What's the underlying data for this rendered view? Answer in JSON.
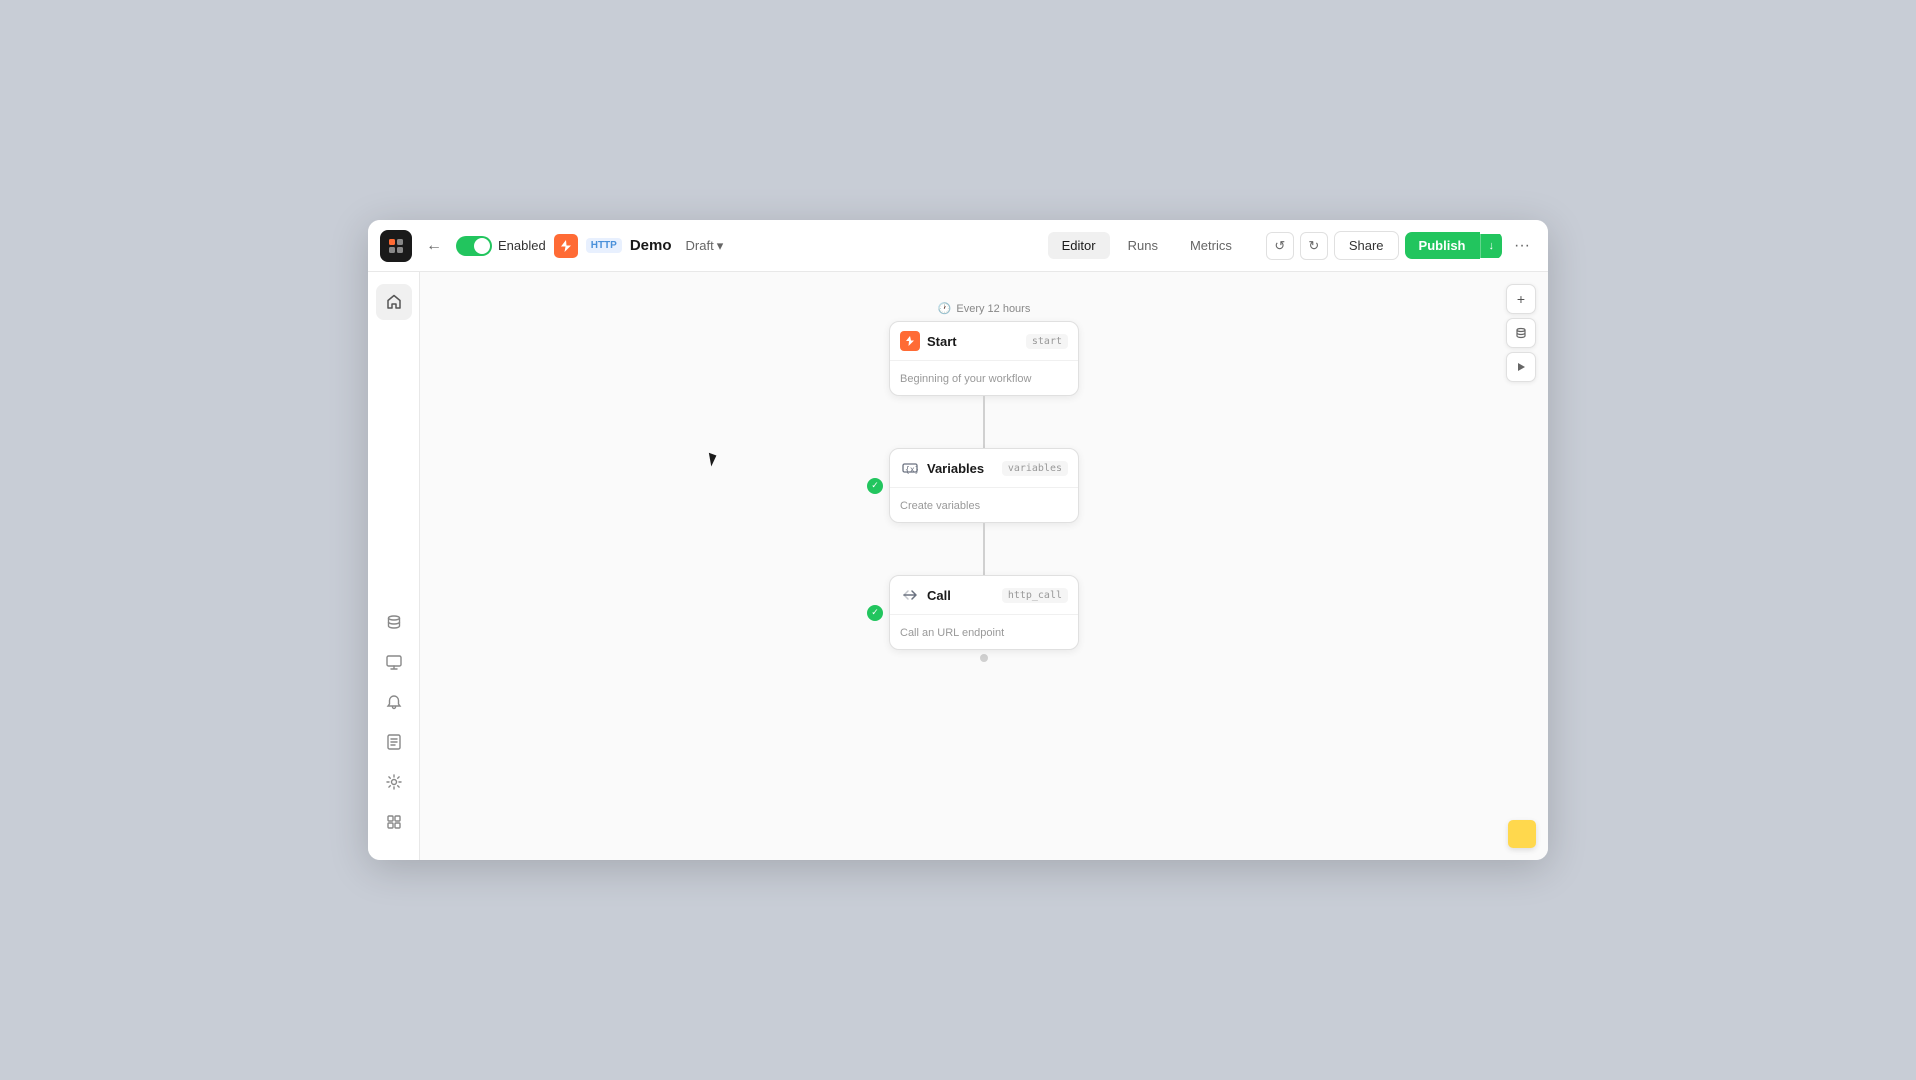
{
  "header": {
    "logo_label": "logo",
    "back_label": "←",
    "toggle_state": "Enabled",
    "trigger_icon": "⚡",
    "http_badge": "HTTP",
    "workflow_name": "Demo",
    "draft_label": "Draft",
    "draft_chevron": "▾",
    "nav": {
      "editor": "Editor",
      "runs": "Runs",
      "metrics": "Metrics"
    },
    "undo": "↺",
    "redo": "↻",
    "share": "Share",
    "publish": "Publish",
    "publish_chevron": "↓",
    "more": "···"
  },
  "sidebar": {
    "home_icon": "⌂",
    "database_icon": "≡",
    "monitor_icon": "◻",
    "bell_icon": "○",
    "book_icon": "☰",
    "settings_icon": "⚙",
    "stack_icon": "⊞"
  },
  "canvas_controls": {
    "plus": "+",
    "database": "≡",
    "play": "▶"
  },
  "workflow": {
    "trigger_schedule": "Every 12 hours",
    "nodes": [
      {
        "id": "start",
        "icon": "⚡",
        "icon_type": "start",
        "title": "Start",
        "badge": "start",
        "description": "Beginning of your workflow",
        "has_check": false
      },
      {
        "id": "variables",
        "icon": "{x}",
        "icon_type": "variables",
        "title": "Variables",
        "badge": "variables",
        "description": "Create variables",
        "has_check": true
      },
      {
        "id": "call",
        "icon": "↔",
        "icon_type": "call",
        "title": "Call",
        "badge": "http_call",
        "description": "Call an URL endpoint",
        "has_check": true
      }
    ]
  }
}
